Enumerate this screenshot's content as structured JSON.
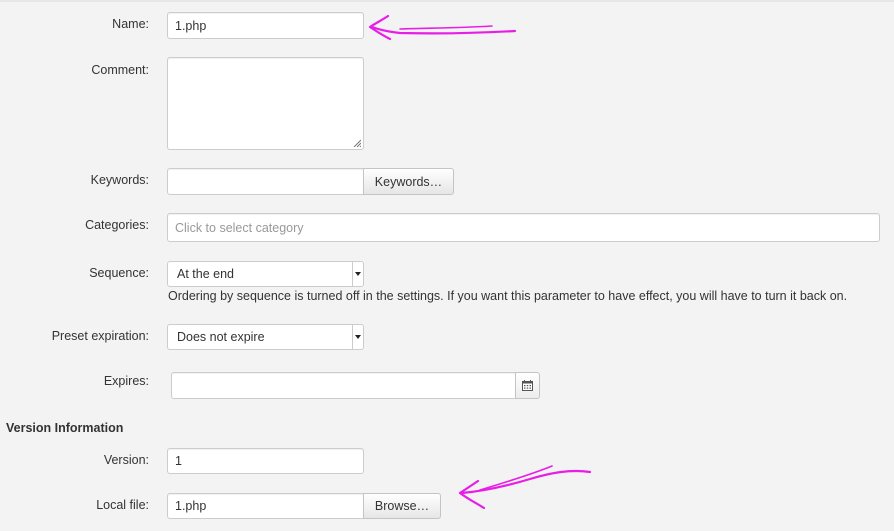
{
  "fields": {
    "name": {
      "label": "Name:",
      "value": "1.php"
    },
    "comment": {
      "label": "Comment:",
      "value": ""
    },
    "keywords": {
      "label": "Keywords:",
      "value": "",
      "button": "Keywords…"
    },
    "categories": {
      "label": "Categories:",
      "placeholder": "Click to select category"
    },
    "sequence": {
      "label": "Sequence:",
      "selected": "At the end",
      "note": "Ordering by sequence is turned off in the settings. If you want this parameter to have effect, you will have to turn it back on."
    },
    "preset_expiration": {
      "label": "Preset expiration:",
      "selected": "Does not expire"
    },
    "expires": {
      "label": "Expires:",
      "value": "",
      "icon": "calendar-icon"
    }
  },
  "version_section": {
    "title": "Version Information",
    "version": {
      "label": "Version:",
      "value": "1"
    },
    "local_file": {
      "label": "Local file:",
      "value": "1.php",
      "button": "Browse…"
    }
  },
  "annotations": {
    "arrow_color": "#e81ee8"
  }
}
